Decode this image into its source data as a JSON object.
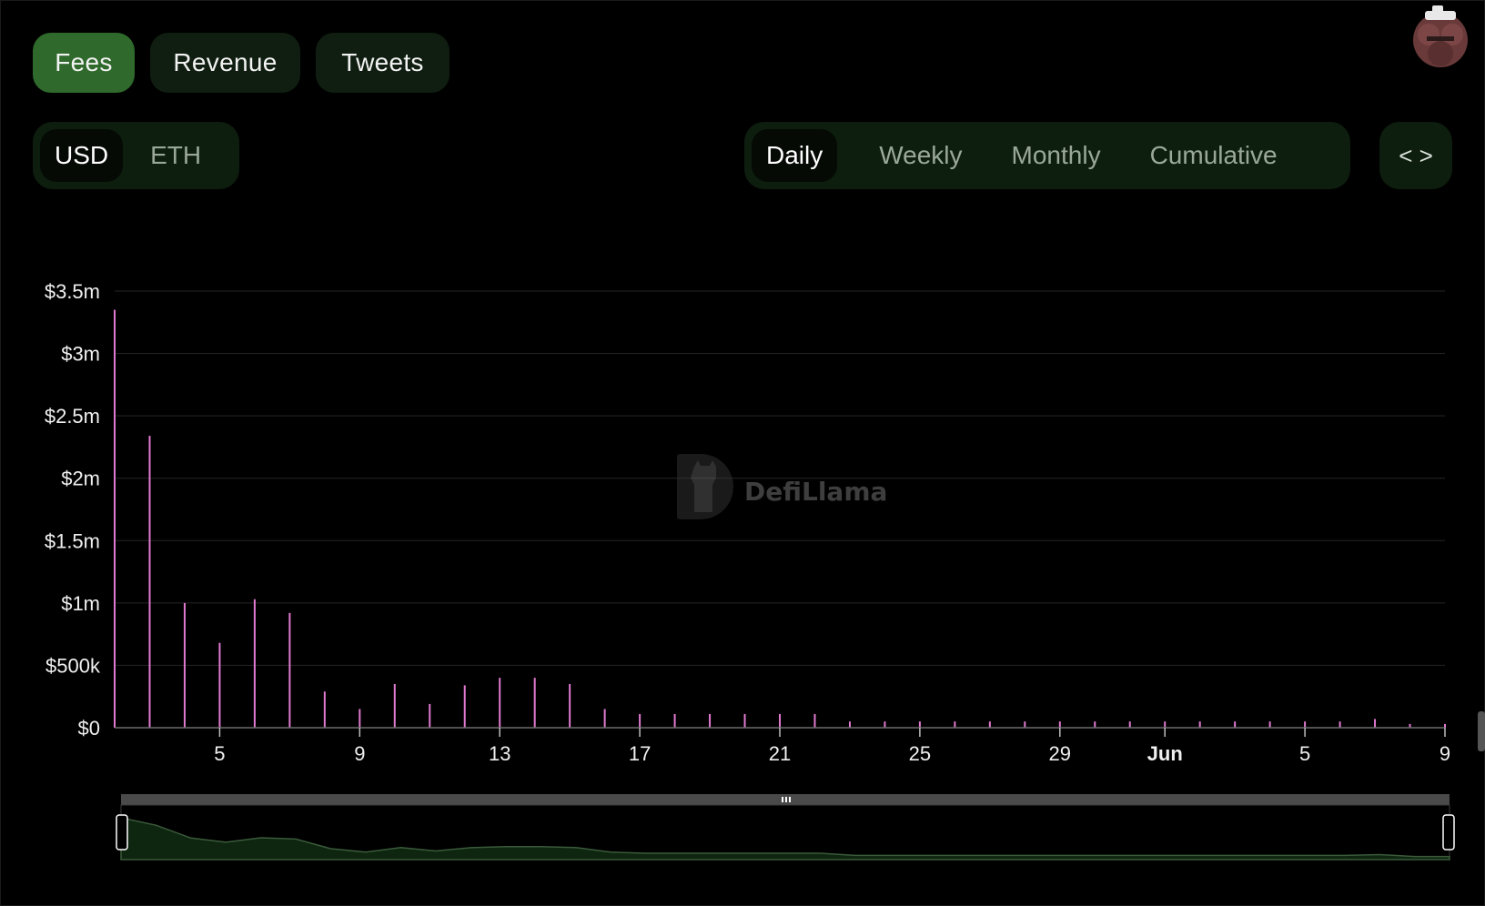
{
  "tabs": [
    {
      "label": "Fees",
      "active": true
    },
    {
      "label": "Revenue",
      "active": false
    },
    {
      "label": "Tweets",
      "active": false
    }
  ],
  "currency": {
    "options": [
      "USD",
      "ETH"
    ],
    "selected": "USD"
  },
  "period": {
    "options": [
      "Daily",
      "Weekly",
      "Monthly",
      "Cumulative"
    ],
    "selected": "Daily"
  },
  "embed_icon": "code-brackets-icon",
  "avatar_icon": "user-avatar-icon",
  "watermark": {
    "text": "DefiLlama"
  },
  "colors": {
    "bar": "#e07ad0",
    "accent": "#2f6a2c",
    "panel": "#0f1e10",
    "brush_fill": "#0e2510"
  },
  "chart_data": {
    "type": "bar",
    "ylim": [
      0,
      3500000
    ],
    "y_ticks": [
      {
        "value": 0,
        "label": "$0"
      },
      {
        "value": 500000,
        "label": "$500k"
      },
      {
        "value": 1000000,
        "label": "$1m"
      },
      {
        "value": 1500000,
        "label": "$1.5m"
      },
      {
        "value": 2000000,
        "label": "$2m"
      },
      {
        "value": 2500000,
        "label": "$2.5m"
      },
      {
        "value": 3000000,
        "label": "$3m"
      },
      {
        "value": 3500000,
        "label": "$3.5m"
      }
    ],
    "x_ticks": [
      {
        "date": "2023-05-05",
        "label": "5",
        "bold": false
      },
      {
        "date": "2023-05-09",
        "label": "9",
        "bold": false
      },
      {
        "date": "2023-05-13",
        "label": "13",
        "bold": false
      },
      {
        "date": "2023-05-17",
        "label": "17",
        "bold": false
      },
      {
        "date": "2023-05-21",
        "label": "21",
        "bold": false
      },
      {
        "date": "2023-05-25",
        "label": "25",
        "bold": false
      },
      {
        "date": "2023-05-29",
        "label": "29",
        "bold": false
      },
      {
        "date": "2023-06-01",
        "label": "Jun",
        "bold": true
      },
      {
        "date": "2023-06-05",
        "label": "5",
        "bold": false
      },
      {
        "date": "2023-06-09",
        "label": "9",
        "bold": false
      }
    ],
    "series": [
      {
        "values": [
          {
            "date": "2023-05-02",
            "value": 3350000
          },
          {
            "date": "2023-05-03",
            "value": 2340000
          },
          {
            "date": "2023-05-04",
            "value": 1000000
          },
          {
            "date": "2023-05-05",
            "value": 680000
          },
          {
            "date": "2023-05-06",
            "value": 1030000
          },
          {
            "date": "2023-05-07",
            "value": 920000
          },
          {
            "date": "2023-05-08",
            "value": 290000
          },
          {
            "date": "2023-05-09",
            "value": 150000
          },
          {
            "date": "2023-05-10",
            "value": 350000
          },
          {
            "date": "2023-05-11",
            "value": 190000
          },
          {
            "date": "2023-05-12",
            "value": 340000
          },
          {
            "date": "2023-05-13",
            "value": 400000
          },
          {
            "date": "2023-05-14",
            "value": 400000
          },
          {
            "date": "2023-05-15",
            "value": 350000
          },
          {
            "date": "2023-05-16",
            "value": 150000
          },
          {
            "date": "2023-05-17",
            "value": 110000
          },
          {
            "date": "2023-05-18",
            "value": 110000
          },
          {
            "date": "2023-05-19",
            "value": 110000
          },
          {
            "date": "2023-05-20",
            "value": 110000
          },
          {
            "date": "2023-05-21",
            "value": 110000
          },
          {
            "date": "2023-05-22",
            "value": 110000
          },
          {
            "date": "2023-05-23",
            "value": 50000
          },
          {
            "date": "2023-05-24",
            "value": 50000
          },
          {
            "date": "2023-05-25",
            "value": 50000
          },
          {
            "date": "2023-05-26",
            "value": 50000
          },
          {
            "date": "2023-05-27",
            "value": 50000
          },
          {
            "date": "2023-05-28",
            "value": 50000
          },
          {
            "date": "2023-05-29",
            "value": 50000
          },
          {
            "date": "2023-05-30",
            "value": 50000
          },
          {
            "date": "2023-05-31",
            "value": 50000
          },
          {
            "date": "2023-06-01",
            "value": 50000
          },
          {
            "date": "2023-06-02",
            "value": 50000
          },
          {
            "date": "2023-06-03",
            "value": 50000
          },
          {
            "date": "2023-06-04",
            "value": 50000
          },
          {
            "date": "2023-06-05",
            "value": 50000
          },
          {
            "date": "2023-06-06",
            "value": 50000
          },
          {
            "date": "2023-06-07",
            "value": 70000
          },
          {
            "date": "2023-06-08",
            "value": 30000
          },
          {
            "date": "2023-06-09",
            "value": 30000
          }
        ]
      }
    ],
    "grid": true,
    "legend": "none"
  }
}
